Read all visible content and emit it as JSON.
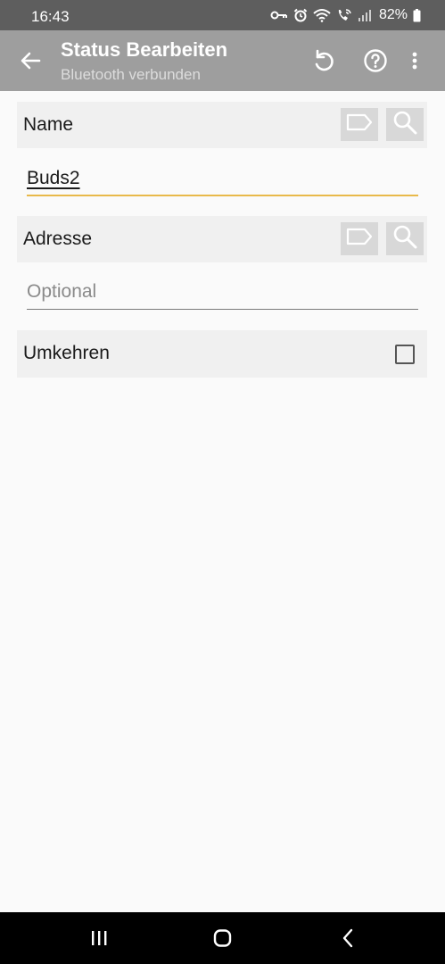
{
  "status_bar": {
    "time": "16:43",
    "battery": "82%",
    "icons": [
      "key-icon",
      "alarm-icon",
      "wifi-icon",
      "wifi-calling-icon",
      "signal-icon",
      "battery-icon"
    ]
  },
  "app_bar": {
    "title": "Status Bearbeiten",
    "subtitle": "Bluetooth verbunden",
    "actions": [
      "undo-icon",
      "help-icon",
      "more-vert-icon"
    ]
  },
  "form": {
    "name_label": "Name",
    "name_value": "Buds2",
    "address_label": "Adresse",
    "address_placeholder": "Optional",
    "invert_label": "Umkehren",
    "invert_checked": false
  },
  "colors": {
    "accent": "#e8b94a",
    "app_bar": "#9e9e9e",
    "status_bar": "#5e5e5e"
  },
  "nav_bar": {
    "buttons": [
      "recents-icon",
      "home-icon",
      "back-icon"
    ]
  }
}
